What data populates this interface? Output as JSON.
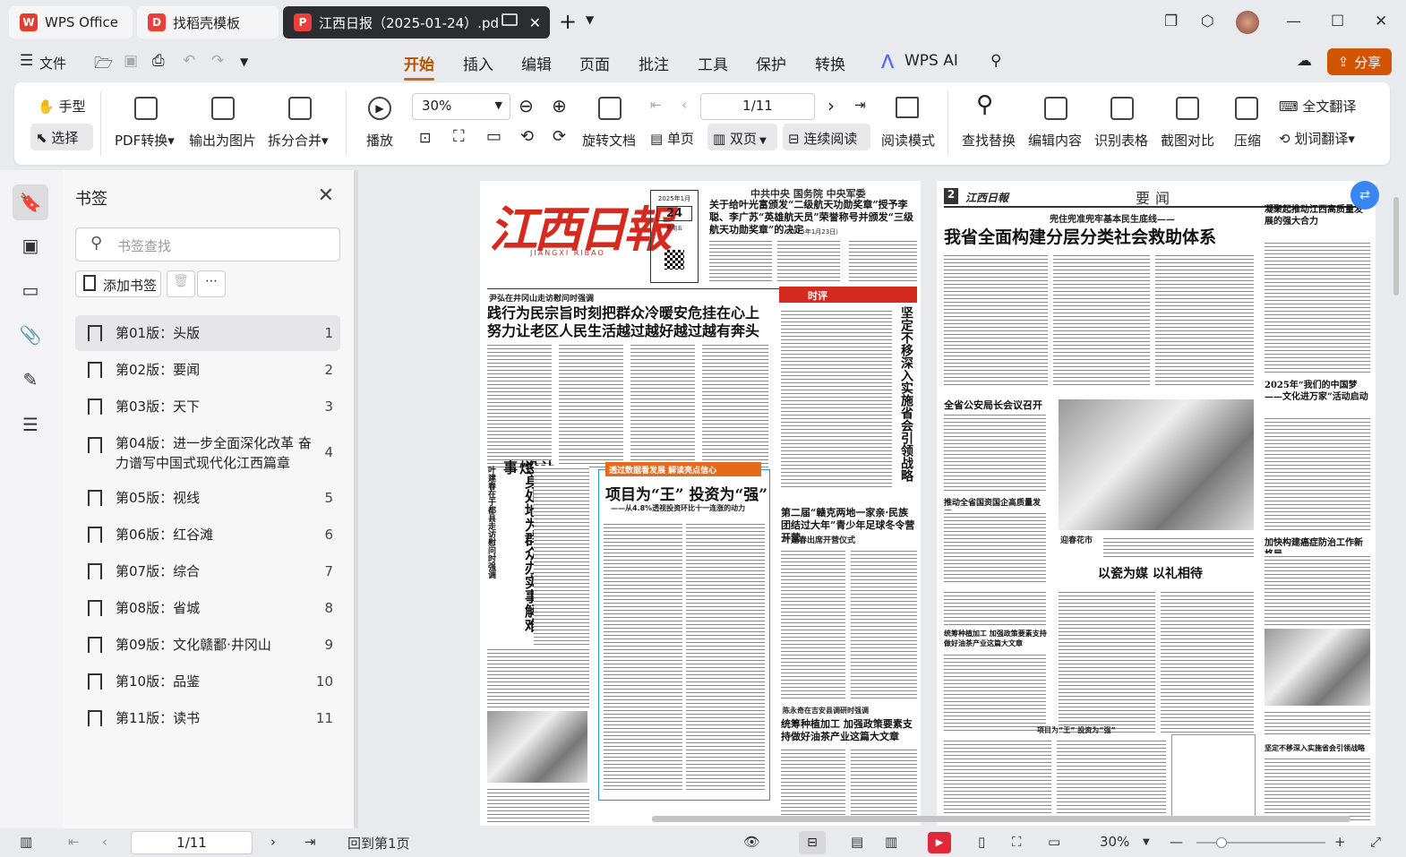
{
  "tabs": [
    {
      "label": "WPS Office",
      "icon": "wps-logo-icon"
    },
    {
      "label": "找稻壳模板",
      "icon": "docer-icon"
    },
    {
      "label": "江西日报（2025-01-24）.pd",
      "icon": "pdf-icon"
    }
  ],
  "menu": {
    "file": "文件",
    "items": [
      "开始",
      "插入",
      "编辑",
      "页面",
      "批注",
      "工具",
      "保护",
      "转换"
    ],
    "active": "开始",
    "wps_ai": "WPS AI",
    "share": "分享"
  },
  "ribbon": {
    "hand": "手型",
    "select": "选择",
    "pdf_convert": "PDF转换",
    "export_image": "输出为图片",
    "split_merge": "拆分合并",
    "play": "播放",
    "zoom": "30%",
    "page": "1/11",
    "rotate": "旋转文档",
    "single": "单页",
    "double": "双页",
    "continuous": "连续阅读",
    "reading": "阅读模式",
    "find_replace": "查找替换",
    "edit_content": "编辑内容",
    "recognize_table": "识别表格",
    "screenshot_compare": "截图对比",
    "compress": "压缩",
    "full_translate": "全文翻译",
    "word_translate": "划词翻译"
  },
  "bookmarks": {
    "title": "书签",
    "search_placeholder": "书签查找",
    "add": "添加书签",
    "items": [
      {
        "label": "第01版：头版",
        "page": "1"
      },
      {
        "label": "第02版：要闻",
        "page": "2"
      },
      {
        "label": "第03版：天下",
        "page": "3"
      },
      {
        "label": "第04版：进一步全面深化改革 奋力谱写中国式现代化江西篇章",
        "page": "4"
      },
      {
        "label": "第05版：视线",
        "page": "5"
      },
      {
        "label": "第06版：红谷滩",
        "page": "6"
      },
      {
        "label": "第07版：综合",
        "page": "7"
      },
      {
        "label": "第08版：省城",
        "page": "8"
      },
      {
        "label": "第09版：文化赣鄱·井冈山",
        "page": "9"
      },
      {
        "label": "第10版：品鉴",
        "page": "10"
      },
      {
        "label": "第11版：读书",
        "page": "11"
      }
    ]
  },
  "page1": {
    "masthead": "江西日報",
    "masthead_en": "JIANGXI RIBAO",
    "date_top": "2025年1月",
    "date_day": "24",
    "date_week": "星期五",
    "top_org": "中共中央 国务院 中央军委",
    "top_head": "关于给叶光富颁发“二级航天功勋奖章”授予李聪、李广苏“英雄航天员”荣誉称号并颁发“三级航天功勋奖章”的决定",
    "top_date": "（2025年1月23日）",
    "kicker": "尹弘在井冈山走访慰问时强调",
    "lead1": "践行为民宗旨时刻把群众冷暖安危挂在心上",
    "lead2": "努力让老区人民生活越过越好越过越有奔头",
    "vert1": "叶建春在于都县走访慰问时强调",
    "vert2": "让群众生活更幸福笑容更灿烂",
    "vert3": "设身处地为群众办实事解难事",
    "column_tag": "时评",
    "column_vert": "坚定不移深入实施省会引领战略",
    "banner": "透过数据看发展 解读亮点信心",
    "feature": "项目为“王” 投资为“强”",
    "feature_sub": "——从4.8%透视投资环比十一连涨的动力",
    "right_head": "第二届“赣克两地一家亲·民族团结过大年”青少年足球冬令营开营",
    "right_sub": "叶建春出席开营仪式",
    "right_kicker": "陈永奇在吉安县调研时强调",
    "right_head2": "统筹种植加工 加强政策要素支持做好油茶产业这篇大文章"
  },
  "page2": {
    "page_no": "2",
    "section": "要闻",
    "masthead": "江西日報",
    "kicker": "兜住兜准兜牢基本民生底线——",
    "lead": "我省全面构建分层分类社会救助体系",
    "side1": "凝聚起推动江西高质量发展的强大合力",
    "side2": "2025年“我们的中国梦——文化进万家”活动启动",
    "side3": "加快构建癌症防治工作新格局",
    "side4": "坚定不移深入实施省会引领战略",
    "mid1": "全省公安局长会议召开",
    "mid2": "推动全省国资国企高质量发展",
    "mid3": "统筹种植加工 加强政策要素支持做好油茶产业这篇大文章",
    "photo_caption": "迎春花市",
    "porcelain": "以瓷为媒 以礼相待",
    "bottom": "项目为“王” 投资为“强”"
  },
  "status": {
    "page": "1/11",
    "goto_first": "回到第1页",
    "zoom": "30%"
  }
}
